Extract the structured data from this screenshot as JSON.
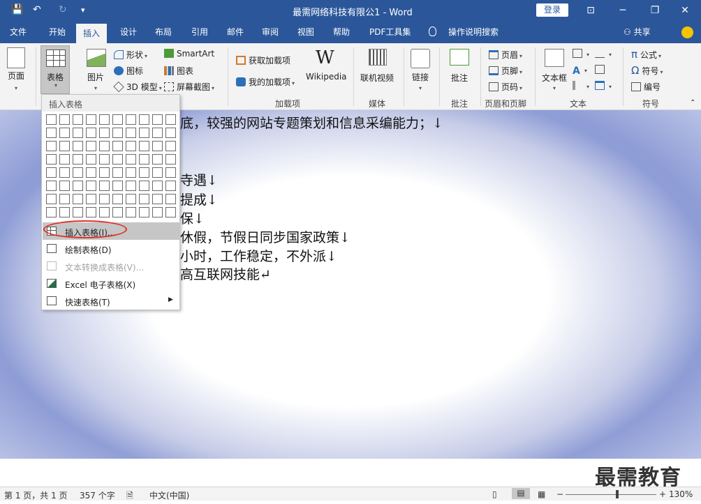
{
  "window": {
    "title": "最需网络科技有限公1  -  Word",
    "login": "登录",
    "minimize": "─",
    "restore": "❐",
    "close": "✕",
    "ribbon_display": "⊡"
  },
  "quick_access": {
    "save": "💾",
    "undo": "↶",
    "redo": "↻",
    "customize": "▾"
  },
  "tabs": [
    {
      "label": "文件"
    },
    {
      "label": "开始"
    },
    {
      "label": "插入",
      "active": true
    },
    {
      "label": "设计"
    },
    {
      "label": "布局"
    },
    {
      "label": "引用"
    },
    {
      "label": "邮件"
    },
    {
      "label": "审阅"
    },
    {
      "label": "视图"
    },
    {
      "label": "帮助"
    },
    {
      "label": "PDF工具集"
    },
    {
      "label": "操作说明搜索"
    }
  ],
  "share": "共享",
  "ribbon": {
    "page": "页面",
    "table": "表格",
    "picture": "图片",
    "shapes": "形状",
    "icons": "图标",
    "model3d": "3D 模型",
    "smartart": "SmartArt",
    "chart": "图表",
    "screenshot": "屏幕截图",
    "get_addins": "获取加载项",
    "my_addins": "我的加载项",
    "wikipedia": "Wikipedia",
    "addins_group": "加载项",
    "online_video": "联机视频",
    "media_group": "媒体",
    "link": "链接",
    "comment": "批注",
    "comment_group": "批注",
    "header": "页眉",
    "footer": "页脚",
    "page_number": "页码",
    "header_footer_group": "页眉和页脚",
    "textbox": "文本框",
    "text_group": "文本",
    "equation": "公式",
    "symbol": "符号",
    "number": "编号",
    "symbol_group": "符号"
  },
  "document": {
    "lines": [
      "底，较强的网站专题策划和信息采编能力；↓",
      "寺遇↓",
      "提成↓",
      "保↓",
      "休假，节假日同步国家政策↓",
      "小时，工作稳定，不外派↓",
      "高互联网技能↵"
    ]
  },
  "dropdown": {
    "header": "插入表格",
    "items": [
      {
        "label": "插入表格(I)...",
        "highlighted": true
      },
      {
        "label": "绘制表格(D)"
      },
      {
        "label": "文本转换成表格(V)...",
        "disabled": true
      },
      {
        "label": "Excel 电子表格(X)"
      },
      {
        "label": "快速表格(T)",
        "submenu": true
      }
    ]
  },
  "status": {
    "page": "第 1 页，共 1 页",
    "words": "357 个字",
    "language": "中文(中国)",
    "zoom": "130%",
    "zoom_minus": "−",
    "zoom_plus": "+"
  },
  "watermark": "最需教育"
}
